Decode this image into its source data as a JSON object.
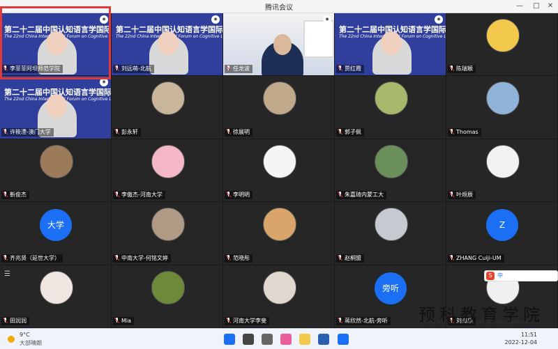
{
  "window": {
    "title": "腾讯会议"
  },
  "participants": [
    {
      "name": "李菲菲阿坝师范学院",
      "tile": "slide",
      "slide_line1": "第二十二届中国认知语言学国际论坛",
      "slide_line2": "The 22nd China International Forum on Cognitive Linguistics",
      "highlighted": true
    },
    {
      "name": "刘远萌-北航",
      "tile": "slide",
      "slide_line1": "第二十二届中国认知语言学国际论坛",
      "slide_line2": "The 22nd China International Forum on Cognitive Linguistics"
    },
    {
      "name": "任龙波",
      "tile": "photo"
    },
    {
      "name": "贾红霞",
      "tile": "slide",
      "slide_line1": "第二十二届中国认知语言学国际论坛",
      "slide_line2": "The 22nd China International Forum on Cognitive Linguistics"
    },
    {
      "name": "陈瑞颖",
      "tile": "avatar",
      "avatar_color": "#f2c94c"
    },
    {
      "name": "许筱澧-澳门大学",
      "tile": "slide",
      "slide_line1": "第二十二届中国认知语言学国际论坛",
      "slide_line2": "The 22nd China International Forum on Cognitive Linguistics"
    },
    {
      "name": "彭永轩",
      "tile": "avatar",
      "avatar_color": "#c9b59a"
    },
    {
      "name": "徐展明",
      "tile": "avatar",
      "avatar_color": "#bfa98a"
    },
    {
      "name": "郭子佩",
      "tile": "avatar",
      "avatar_color": "#a7b86a"
    },
    {
      "name": "Thomas",
      "tile": "avatar",
      "avatar_color": "#8fb3d9"
    },
    {
      "name": "靳俊杰",
      "tile": "avatar",
      "avatar_color": "#9b7b5a"
    },
    {
      "name": "李傲杰-河南大学",
      "tile": "avatar",
      "avatar_color": "#f3b7c7"
    },
    {
      "name": "李明明",
      "tile": "avatar",
      "avatar_color": "#f5f5f5"
    },
    {
      "name": "朱嘉琦内蒙工大",
      "tile": "avatar",
      "avatar_color": "#6b8f5a"
    },
    {
      "name": "叶烜辰",
      "tile": "avatar",
      "avatar_color": "#f2f2f2"
    },
    {
      "name": "齐兆贤（延世大学）",
      "tile": "initials",
      "initials": "大学"
    },
    {
      "name": "中南大学-何铭文婷",
      "tile": "avatar",
      "avatar_color": "#b09a86"
    },
    {
      "name": "范晓彤",
      "tile": "avatar",
      "avatar_color": "#d9a56a"
    },
    {
      "name": "赵桐盟",
      "tile": "avatar",
      "avatar_color": "#c7c9d1"
    },
    {
      "name": "ZHANG Cuiji-UM",
      "tile": "initials",
      "initials": "Z"
    },
    {
      "name": "田润润",
      "tile": "avatar",
      "avatar_color": "#f0e6e1",
      "has_more_button": true
    },
    {
      "name": "Mia",
      "tile": "avatar",
      "avatar_color": "#6c8a3a"
    },
    {
      "name": "河南大学李斐",
      "tile": "avatar",
      "avatar_color": "#e0d7cf"
    },
    {
      "name": "蒋欣然-北航-旁听",
      "tile": "initials",
      "initials": "旁听"
    },
    {
      "name": "刘海乐",
      "tile": "avatar",
      "avatar_color": "#f0f0f0"
    }
  ],
  "ime": {
    "lang": "中"
  },
  "watermark": {
    "text": "预科教育学院",
    "sub": "SCHOOL OF PREPARATORY EDUCATION"
  },
  "taskbar": {
    "weather_temp": "9°C",
    "weather_desc": "大部晴朗",
    "time": "11:51",
    "date": "2022-12-04"
  },
  "colors": {
    "accent": "#1a6ff4",
    "highlight_frame": "#e03a3a",
    "slide_bg": "#2f3f9b"
  }
}
